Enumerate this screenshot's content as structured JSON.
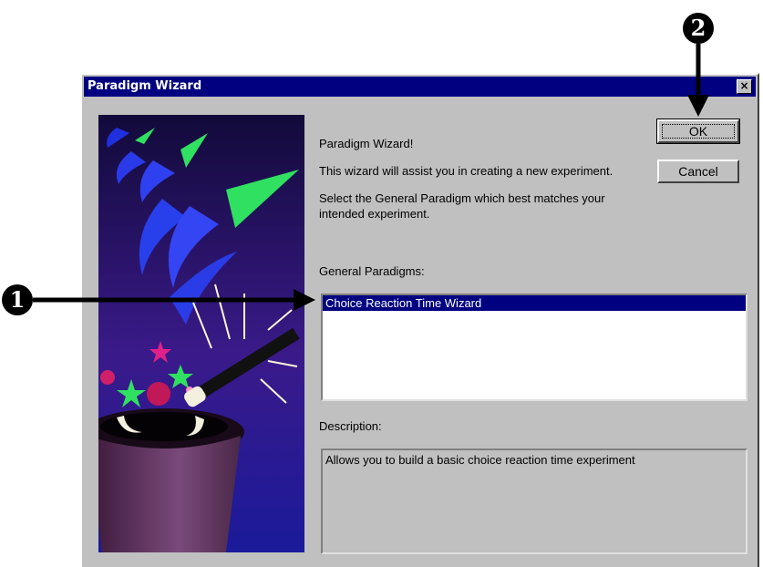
{
  "window": {
    "title": "Paradigm Wizard",
    "close_glyph": "×"
  },
  "intro": {
    "heading": "Paradigm Wizard!",
    "assist_text": "This wizard will assist you in creating a new experiment.",
    "select_line1": "Select the General Paradigm which best matches your",
    "select_line2": "intended experiment."
  },
  "buttons": {
    "ok": "OK",
    "cancel": "Cancel"
  },
  "paradigms": {
    "label": "General Paradigms:",
    "items": [
      "Choice Reaction Time Wizard"
    ],
    "selected_index": 0
  },
  "description": {
    "label": "Description:",
    "text": "Allows you to build a basic choice reaction time experiment"
  },
  "callouts": {
    "one": "1",
    "two": "2"
  },
  "colors": {
    "titlebar": "#000080",
    "dialog_bg": "#c0c0c0",
    "selection": "#000080"
  }
}
